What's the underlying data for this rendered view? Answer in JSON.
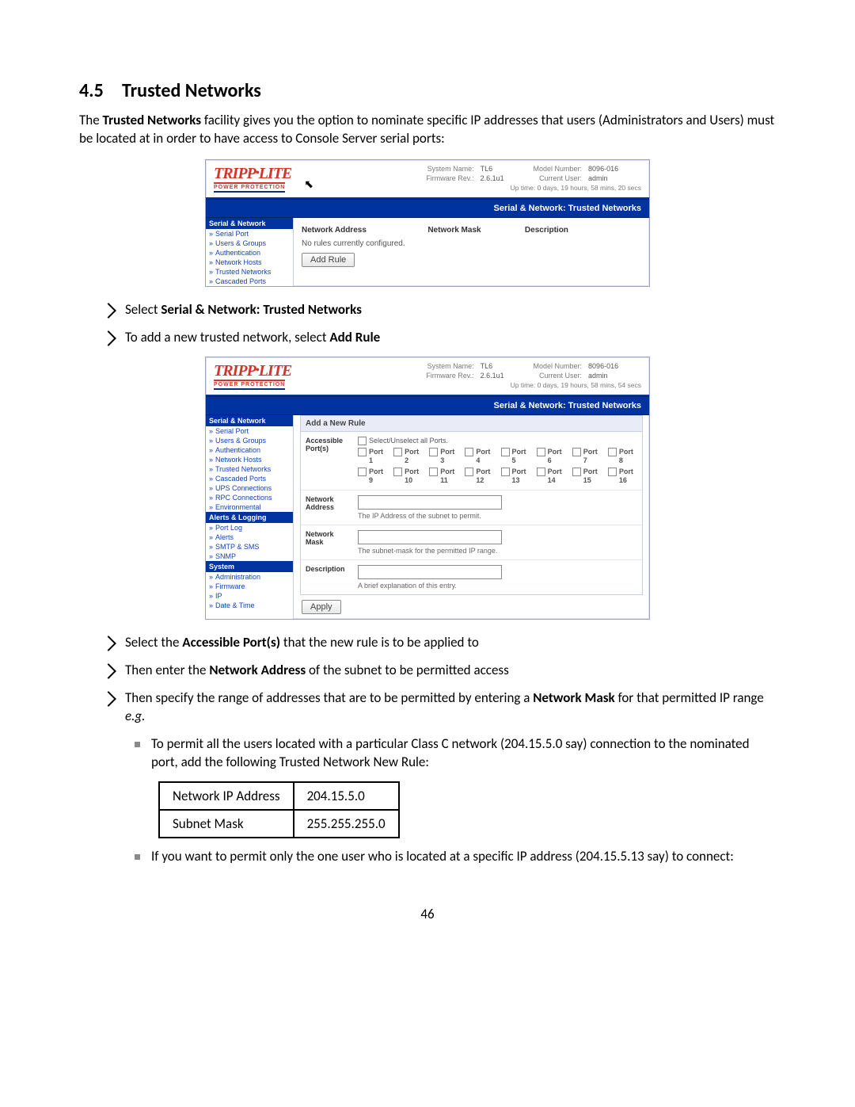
{
  "section": {
    "number": "4.5",
    "title": "Trusted Networks"
  },
  "intro_pre": "The ",
  "intro_bold": "Trusted Networks",
  "intro_post": " facility gives you the option to nominate specific IP addresses that users (Administrators and Users) must be located at in order to have access to Console Server serial ports:",
  "gui1": {
    "brand": "TRIPP",
    "brand2": "LITE",
    "tag": "POWER PROTECTION",
    "sys": {
      "name_l": "System Name:",
      "name_v": "TL6",
      "fw_l": "Firmware Rev.:",
      "fw_v": "2.6.1u1",
      "model_l": "Model Number:",
      "model_v": "8096-016",
      "user_l": "Current User:",
      "user_v": "admin",
      "uptime_l": "Up time:",
      "uptime_v": "0 days, 19 hours, 58 mins, 20 secs"
    },
    "title": "Serial & Network: Trusted Networks",
    "side_sec": "Serial & Network",
    "side_items": [
      "Serial Port",
      "Users & Groups",
      "Authentication",
      "Network Hosts",
      "Trusted Networks",
      "Cascaded Ports"
    ],
    "cols": {
      "addr": "Network Address",
      "mask": "Network Mask",
      "desc": "Description"
    },
    "no_rules": "No rules currently configured.",
    "add_rule": "Add Rule",
    "cursor": "↖"
  },
  "step1_a": "Select ",
  "step1_b": "Serial & Network: Trusted Networks",
  "step2_a": "To add a new trusted network, select ",
  "step2_b": "Add Rule",
  "gui2": {
    "sys": {
      "name_l": "System Name:",
      "name_v": "TL6",
      "fw_l": "Firmware Rev.:",
      "fw_v": "2.6.1u1",
      "model_l": "Model Number:",
      "model_v": "8096-016",
      "user_l": "Current User:",
      "user_v": "admin",
      "uptime_l": "Up time:",
      "uptime_v": "0 days, 19 hours, 58 mins, 54 secs"
    },
    "title": "Serial & Network: Trusted Networks",
    "side": {
      "sec1": "Serial & Network",
      "items1": [
        "Serial Port",
        "Users & Groups",
        "Authentication",
        "Network Hosts",
        "Trusted Networks",
        "Cascaded Ports",
        "UPS Connections",
        "RPC Connections",
        "Environmental"
      ],
      "sec2": "Alerts & Logging",
      "items2": [
        "Port Log",
        "Alerts",
        "SMTP & SMS",
        "SNMP"
      ],
      "sec3": "System",
      "items3": [
        "Administration",
        "Firmware",
        "IP",
        "Date & Time"
      ]
    },
    "panel_title": "Add a New Rule",
    "f_ports": "Accessible Port(s)",
    "select_all": "Select/Unselect all Ports.",
    "port_label": "Port",
    "f_addr": "Network Address",
    "f_addr_help": "The IP Address of the subnet to permit.",
    "f_mask": "Network Mask",
    "f_mask_help": "The subnet-mask for the permitted IP range.",
    "f_desc": "Description",
    "f_desc_help": "A brief explanation of this entry.",
    "apply": "Apply"
  },
  "step3_a": "Select the ",
  "step3_b": "Accessible Port(s)",
  "step3_c": " that the new rule is to be applied to",
  "step4_a": "Then enter the ",
  "step4_b": "Network Address",
  "step4_c": " of the subnet to be permitted access",
  "step5_a": "Then specify the range of addresses that are to be permitted by entering a ",
  "step5_b": "Network Mask",
  "step5_c": " for that permitted IP range ",
  "step5_d": "e.g.",
  "sub1": "To permit all the users located with a particular Class C network (204.15.5.0 say) connection to the nominated port, add the following Trusted Network New Rule:",
  "ex": {
    "r1c1": "Network IP Address",
    "r1c2": "204.15.5.0",
    "r2c1": "Subnet Mask",
    "r2c2": "255.255.255.0"
  },
  "sub2": "If you want to permit only the one user who is located at a specific IP address (204.15.5.13 say) to connect:",
  "page_number": "46"
}
